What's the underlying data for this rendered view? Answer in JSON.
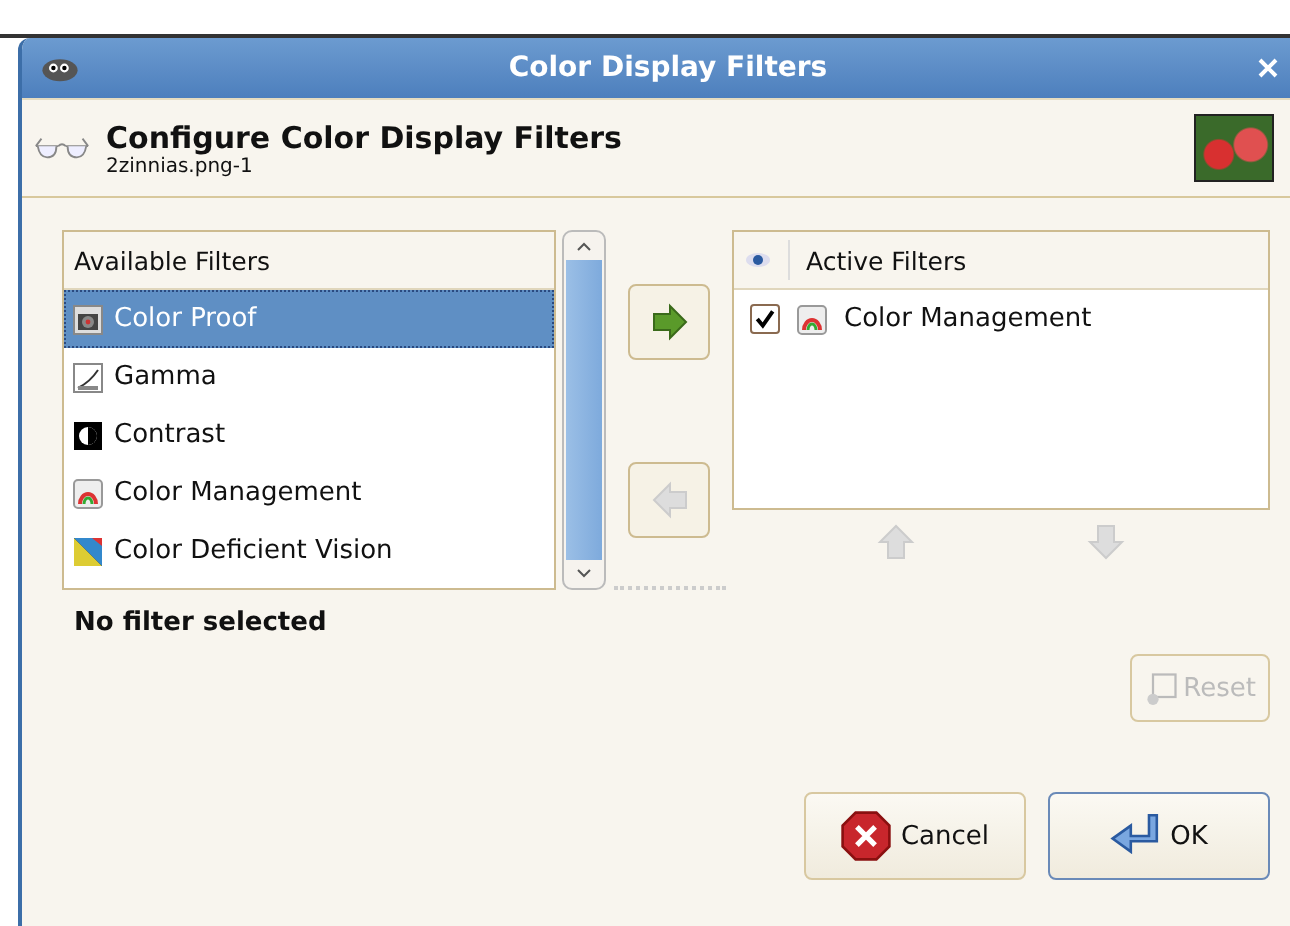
{
  "window": {
    "title": "Color Display Filters"
  },
  "header": {
    "title": "Configure Color Display Filters",
    "subtitle": "2zinnias.png-1"
  },
  "available_filters": {
    "heading": "Available Filters",
    "items": [
      {
        "label": "Color Proof",
        "kind": "proof",
        "selected": true
      },
      {
        "label": "Gamma",
        "kind": "gamma",
        "selected": false
      },
      {
        "label": "Contrast",
        "kind": "contrast",
        "selected": false
      },
      {
        "label": "Color Management",
        "kind": "management",
        "selected": false
      },
      {
        "label": "Color Deficient Vision",
        "kind": "deficient",
        "selected": false
      }
    ]
  },
  "move_buttons": [
    {
      "kind": "add",
      "disabled": false
    },
    {
      "kind": "remove",
      "disabled": true
    }
  ],
  "active_filters": {
    "heading": "Active Filters",
    "items": [
      {
        "label": "Color Management",
        "kind": "management",
        "checked": true
      }
    ]
  },
  "reorder_buttons": [
    {
      "kind": "up",
      "disabled": true
    },
    {
      "kind": "down",
      "disabled": true
    }
  ],
  "status": "No filter selected",
  "reset_button": {
    "label": "Reset",
    "disabled": true
  },
  "buttons": [
    {
      "kind": "cancel",
      "label": "Cancel",
      "focused": false
    },
    {
      "kind": "ok",
      "label": "OK",
      "focused": true
    }
  ]
}
